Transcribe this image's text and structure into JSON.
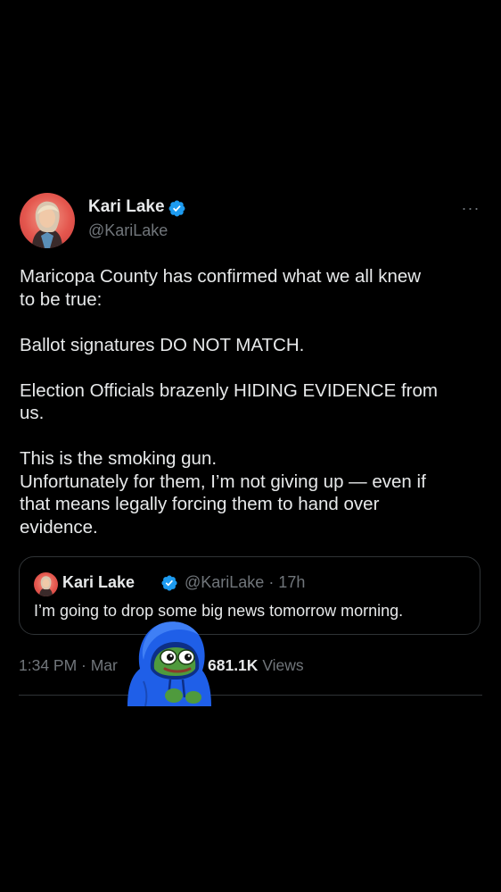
{
  "author": {
    "name": "Kari Lake",
    "handle": "@KariLake"
  },
  "tweet": {
    "paragraphs": [
      [
        "Maricopa County has confirmed what we all knew",
        "to be true:"
      ],
      [
        "Ballot signatures DO NOT MATCH."
      ],
      [
        "Election Officials brazenly HIDING EVIDENCE from",
        "us."
      ],
      [
        "This is the smoking gun.",
        "Unfortunately for them, I’m not giving up — even if",
        "that means legally forcing them to hand over",
        "evidence."
      ]
    ]
  },
  "quoted_tweet": {
    "name": "Kari Lake",
    "meta": "@KariLake · 17h",
    "text": "I’m going to drop some big news tomorrow morning."
  },
  "footer": {
    "timestamp_visible": "1:34 PM · Mar",
    "views_count": "681.1K",
    "views_label": "Views"
  },
  "icons": {
    "verified": "verified-badge-icon",
    "more": "more-options-icon",
    "sticker": "hooded-frog-sticker"
  },
  "colors": {
    "background": "#000000",
    "text_primary": "#e7e9ea",
    "text_secondary": "#71767b",
    "verified_blue": "#1d9bf0",
    "border": "#2f3336",
    "sticker_hoodie": "#1f5fe8",
    "sticker_frog": "#4f9a3d"
  }
}
